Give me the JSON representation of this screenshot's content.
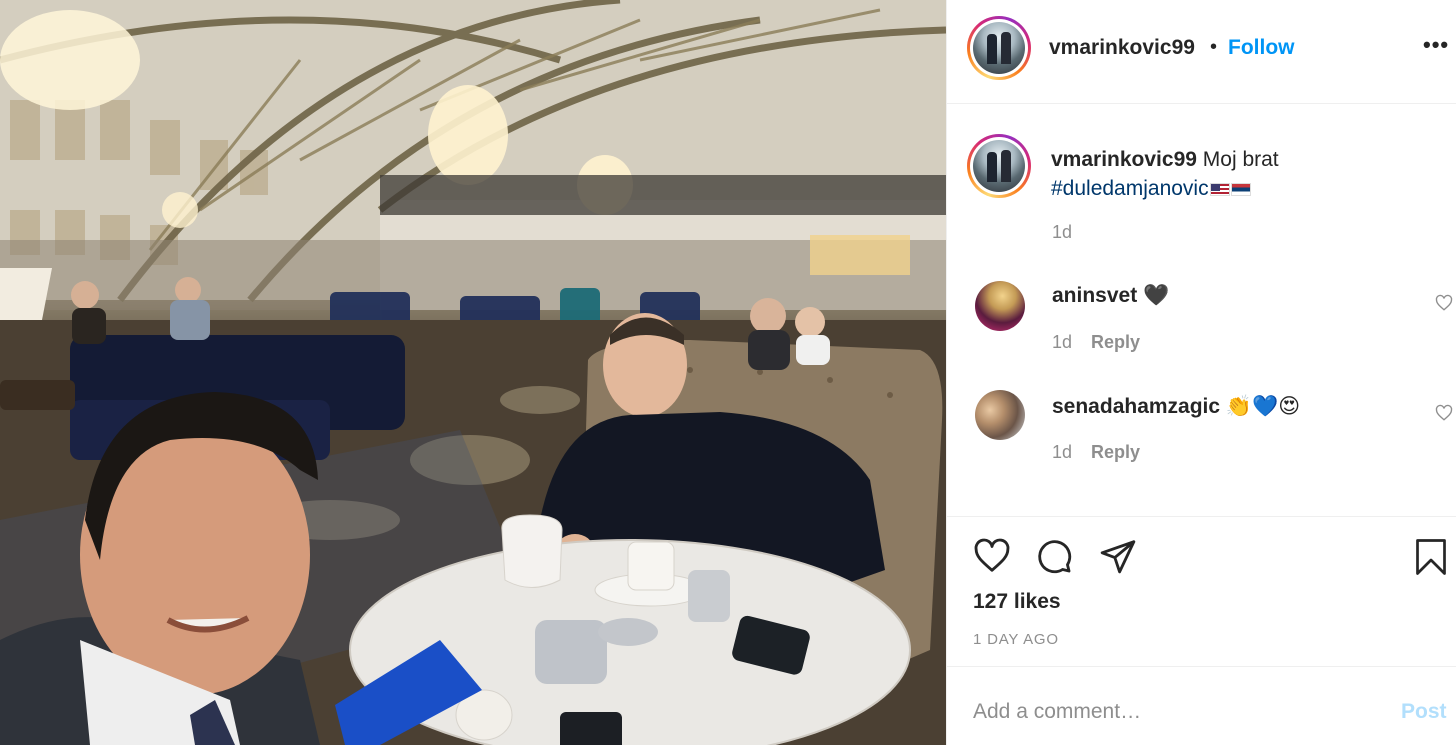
{
  "header": {
    "username": "vmarinkovic99",
    "separator": "•",
    "follow_label": "Follow",
    "more_label": "•••"
  },
  "caption": {
    "username": "vmarinkovic99",
    "text": "Moj brat",
    "hashtag": "#duledamjanovic",
    "flags": [
      "us-flag",
      "serbia-flag"
    ],
    "time": "1d"
  },
  "comments": [
    {
      "username": "aninsvet",
      "text": "🖤",
      "time": "1d",
      "reply_label": "Reply"
    },
    {
      "username": "senadahamzagic",
      "text": "👏💙😍",
      "time": "1d",
      "reply_label": "Reply"
    }
  ],
  "actions": {
    "icons": [
      "heart-icon",
      "comment-icon",
      "share-icon",
      "bookmark-icon"
    ],
    "likes": "127 likes",
    "date": "1 DAY AGO"
  },
  "comment_bar": {
    "placeholder": "Add a comment…",
    "post_label": "Post"
  },
  "colors": {
    "accent": "#0095f6",
    "hashtag": "#00376b",
    "muted": "#8e8e8e",
    "post_disabled": "#b2dffc"
  }
}
